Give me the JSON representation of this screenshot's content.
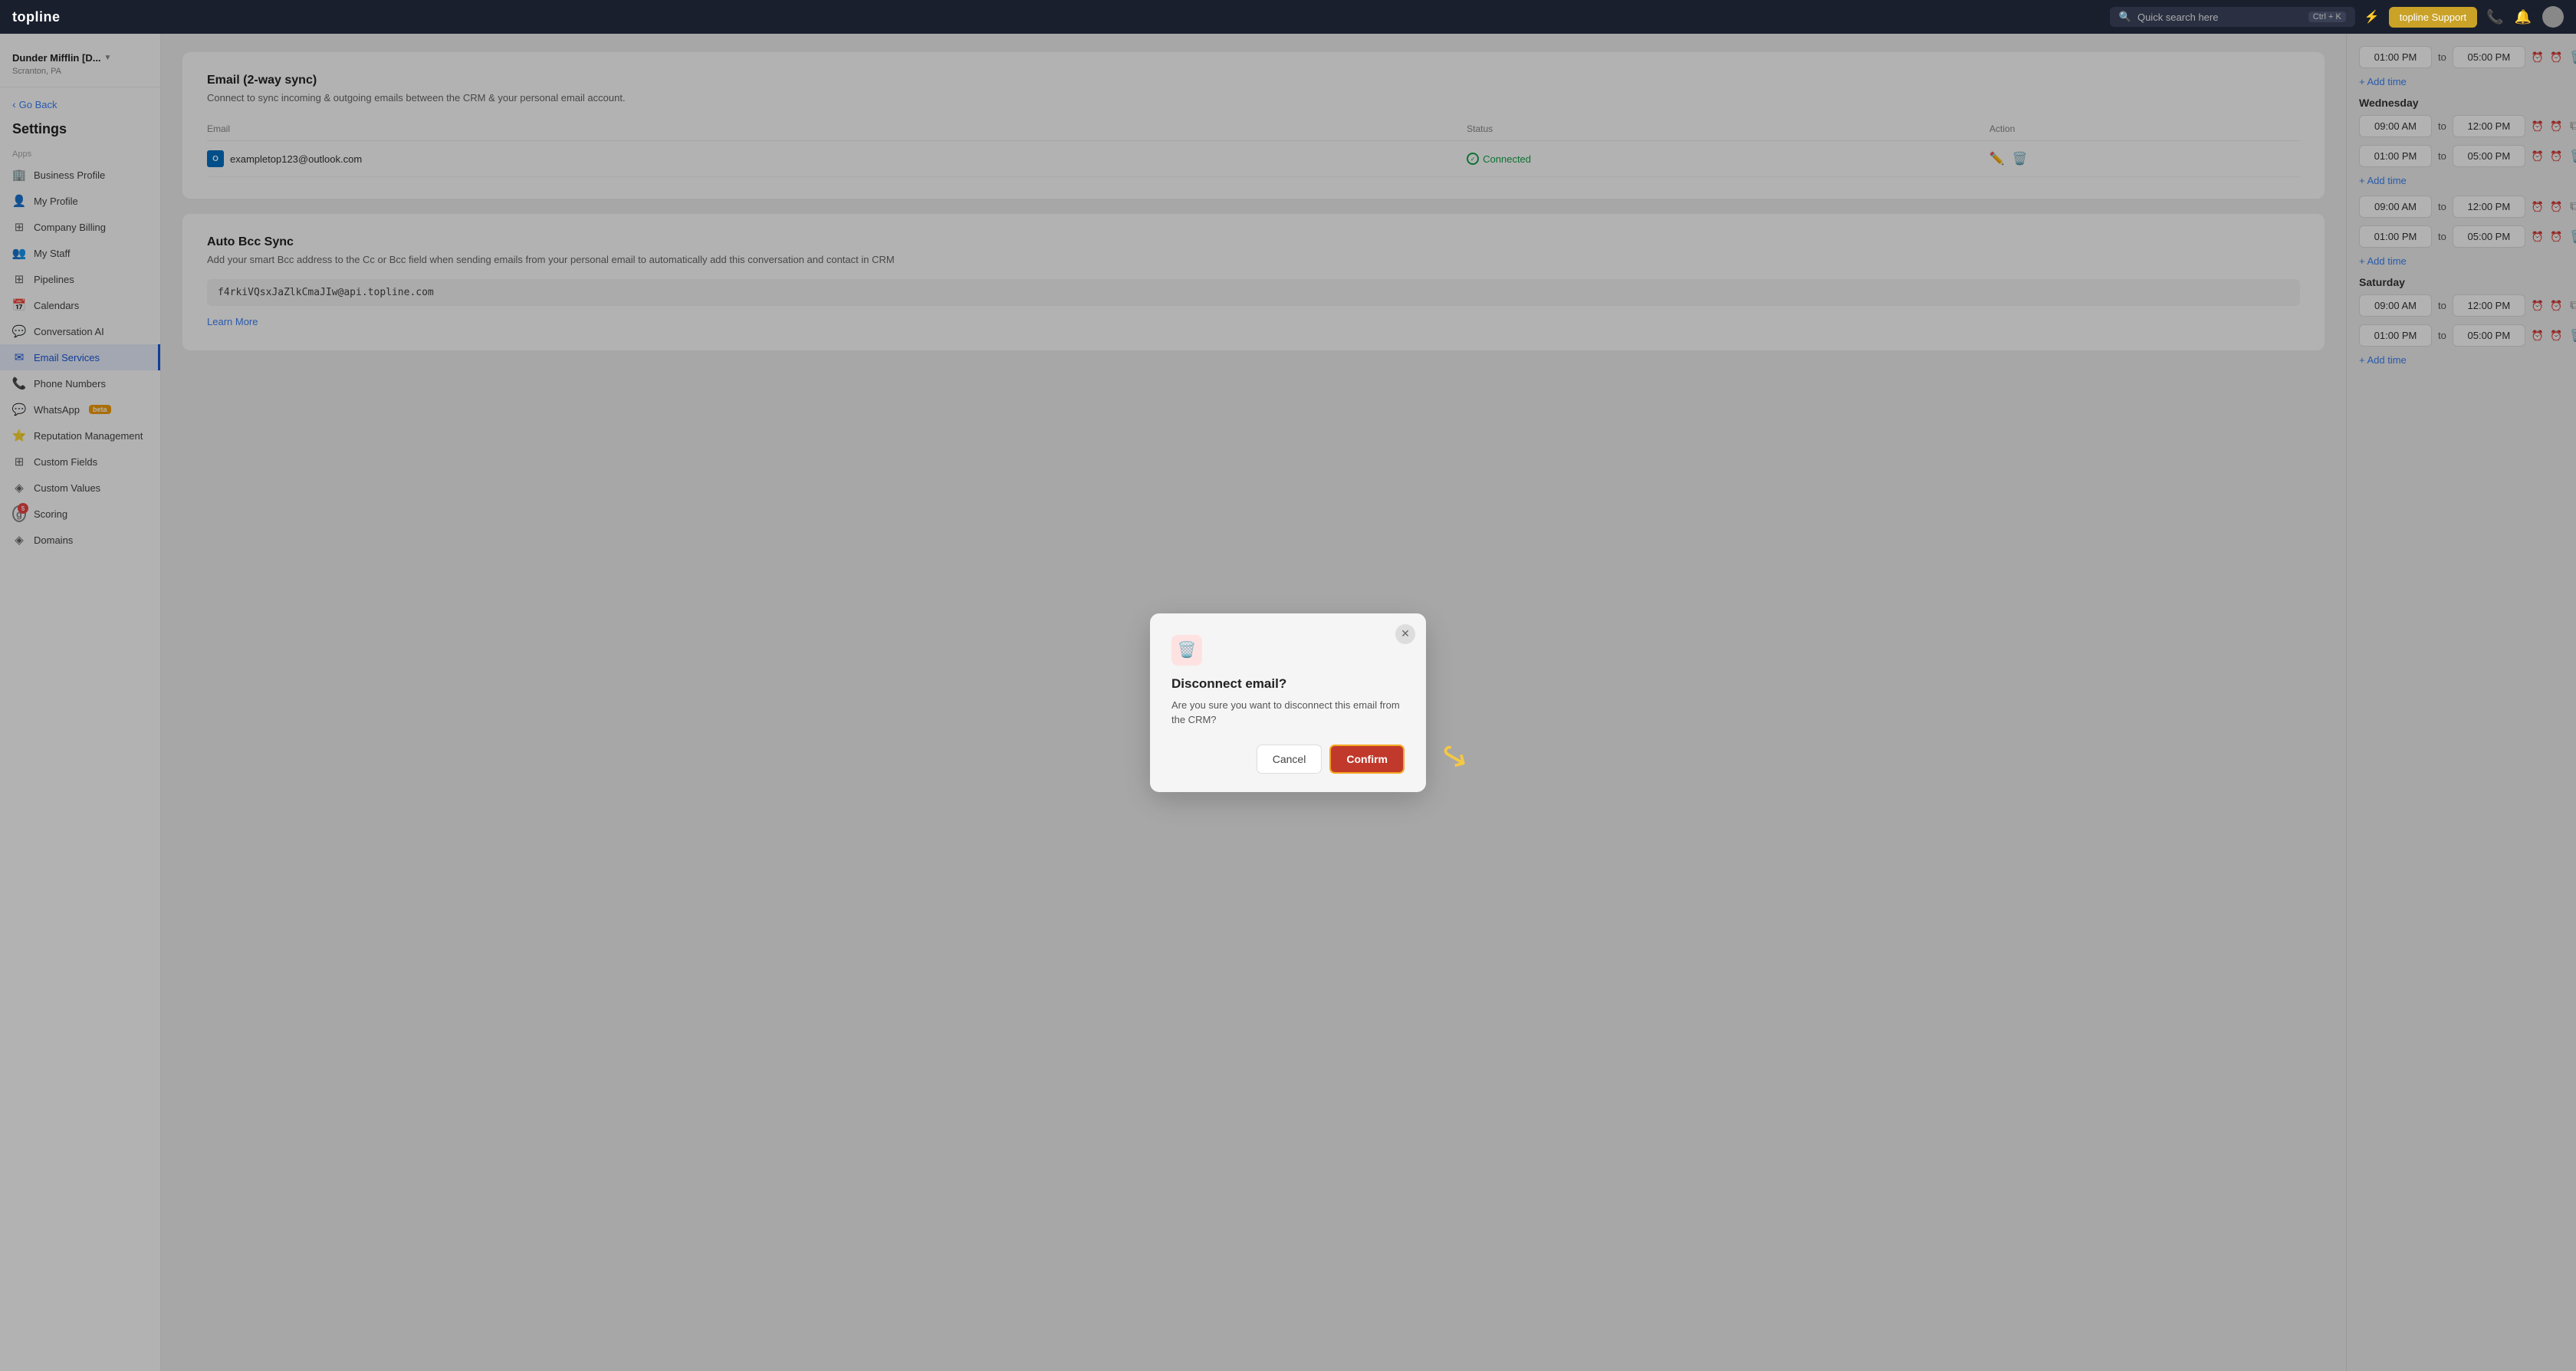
{
  "app": {
    "logo": "topline",
    "search_placeholder": "Quick search here",
    "search_shortcut": "Ctrl + K",
    "support_btn": "topline Support",
    "bolt_icon": "⚡"
  },
  "sidebar": {
    "workspace": {
      "name": "Dunder Mifflin [D...",
      "location": "Scranton, PA"
    },
    "go_back": "Go Back",
    "settings_title": "Settings",
    "section_apps": "Apps",
    "items": [
      {
        "id": "business-profile",
        "icon": "🏢",
        "label": "Business Profile"
      },
      {
        "id": "my-profile",
        "icon": "👤",
        "label": "My Profile",
        "active": true
      },
      {
        "id": "company-billing",
        "icon": "⊞",
        "label": "Company Billing"
      },
      {
        "id": "my-staff",
        "icon": "📅",
        "label": "My Staff"
      },
      {
        "id": "pipelines",
        "icon": "⊞",
        "label": "Pipelines"
      },
      {
        "id": "calendars",
        "icon": "📅",
        "label": "Calendars"
      },
      {
        "id": "conversation-ai",
        "icon": "💬",
        "label": "Conversation AI"
      },
      {
        "id": "email-services",
        "icon": "✉",
        "label": "Email Services"
      },
      {
        "id": "phone-numbers",
        "icon": "📞",
        "label": "Phone Numbers"
      },
      {
        "id": "whatsapp",
        "icon": "💬",
        "label": "WhatsApp",
        "badge": "beta"
      },
      {
        "id": "reputation-management",
        "icon": "⭐",
        "label": "Reputation Management"
      },
      {
        "id": "custom-fields",
        "icon": "⊞",
        "label": "Custom Fields"
      },
      {
        "id": "custom-values",
        "icon": "◈",
        "label": "Custom Values"
      },
      {
        "id": "scoring",
        "icon": "g",
        "label": "Scoring",
        "special": true,
        "count": "5"
      },
      {
        "id": "domains",
        "icon": "◈",
        "label": "Domains"
      }
    ]
  },
  "email_section": {
    "title": "Email (2-way sync)",
    "description": "Connect to sync incoming & outgoing emails between the CRM & your personal email account.",
    "table": {
      "headers": [
        "Email",
        "Status",
        "Action"
      ],
      "rows": [
        {
          "email": "exampletop123@outlook.com",
          "email_icon": "O",
          "status": "Connected"
        }
      ]
    }
  },
  "bcc_section": {
    "title": "Auto Bcc Sync",
    "description": "Add your smart Bcc address to the Cc or Bcc field when sending emails from your personal email to automatically add this conversation and contact in CRM",
    "address": "f4rkiVQsxJaZlkCmaJIw@api.topline.com",
    "learn_more": "Learn More"
  },
  "schedule": {
    "days": [
      {
        "label": "",
        "slots": [
          {
            "from": "01:00 PM",
            "to": "05:00 PM",
            "deletable": true
          }
        ],
        "add_time": "+ Add time"
      },
      {
        "label": "Wednesday",
        "slots": [
          {
            "from": "09:00 AM",
            "to": "12:00 PM",
            "deletable": false
          },
          {
            "from": "01:00 PM",
            "to": "05:00 PM",
            "deletable": true
          }
        ],
        "add_time": "+ Add time"
      },
      {
        "label": "",
        "slots": [
          {
            "from": "09:00 AM",
            "to": "12:00 PM",
            "deletable": false
          },
          {
            "from": "01:00 PM",
            "to": "05:00 PM",
            "deletable": true
          }
        ],
        "add_time": "+ Add time"
      },
      {
        "label": "Saturday",
        "slots": [
          {
            "from": "09:00 AM",
            "to": "12:00 PM",
            "deletable": false
          },
          {
            "from": "01:00 PM",
            "to": "05:00 PM",
            "deletable": true
          }
        ],
        "add_time": "+ Add time"
      }
    ]
  },
  "modal": {
    "title": "Disconnect email?",
    "body": "Are you sure you want to disconnect this email from the CRM?",
    "cancel_label": "Cancel",
    "confirm_label": "Confirm"
  }
}
